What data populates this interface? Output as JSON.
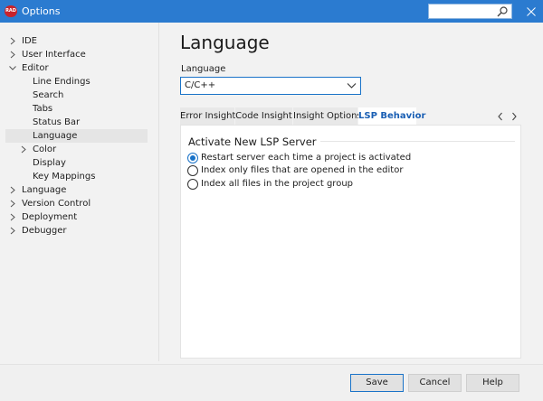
{
  "window": {
    "title": "Options",
    "app_icon_text": "RAD"
  },
  "tree": {
    "items": [
      {
        "label": "IDE",
        "expandable": true,
        "expanded": false,
        "level": 0
      },
      {
        "label": "User Interface",
        "expandable": true,
        "expanded": false,
        "level": 0
      },
      {
        "label": "Editor",
        "expandable": true,
        "expanded": true,
        "level": 0
      },
      {
        "label": "Line Endings",
        "expandable": false,
        "level": 1
      },
      {
        "label": "Search",
        "expandable": false,
        "level": 1
      },
      {
        "label": "Tabs",
        "expandable": false,
        "level": 1
      },
      {
        "label": "Status Bar",
        "expandable": false,
        "level": 1
      },
      {
        "label": "Language",
        "expandable": false,
        "level": 1,
        "selected": true
      },
      {
        "label": "Color",
        "expandable": true,
        "expanded": false,
        "level": 1
      },
      {
        "label": "Display",
        "expandable": false,
        "level": 1
      },
      {
        "label": "Key Mappings",
        "expandable": false,
        "level": 1
      },
      {
        "label": "Language",
        "expandable": true,
        "expanded": false,
        "level": 0
      },
      {
        "label": "Version Control",
        "expandable": true,
        "expanded": false,
        "level": 0
      },
      {
        "label": "Deployment",
        "expandable": true,
        "expanded": false,
        "level": 0
      },
      {
        "label": "Debugger",
        "expandable": true,
        "expanded": false,
        "level": 0
      }
    ]
  },
  "page": {
    "title": "Language",
    "language_label": "Language",
    "language_value": "C/C++"
  },
  "tabs": [
    {
      "label": "Error Insight",
      "active": false
    },
    {
      "label": "Code Insight",
      "active": false
    },
    {
      "label": "Insight Options",
      "active": false
    },
    {
      "label": "LSP Behavior",
      "active": true
    }
  ],
  "panel": {
    "section_title": "Activate New LSP Server",
    "options": [
      {
        "label": "Restart server each time a project is activated",
        "checked": true
      },
      {
        "label": "Index only files that are opened in the editor",
        "checked": false
      },
      {
        "label": "Index all files in the project group",
        "checked": false
      }
    ]
  },
  "buttons": {
    "save": "Save",
    "cancel": "Cancel",
    "help": "Help"
  },
  "colors": {
    "titlebar": "#2b7bd0",
    "accent": "#1a73c8",
    "active_tab_text": "#1a5fb4"
  }
}
